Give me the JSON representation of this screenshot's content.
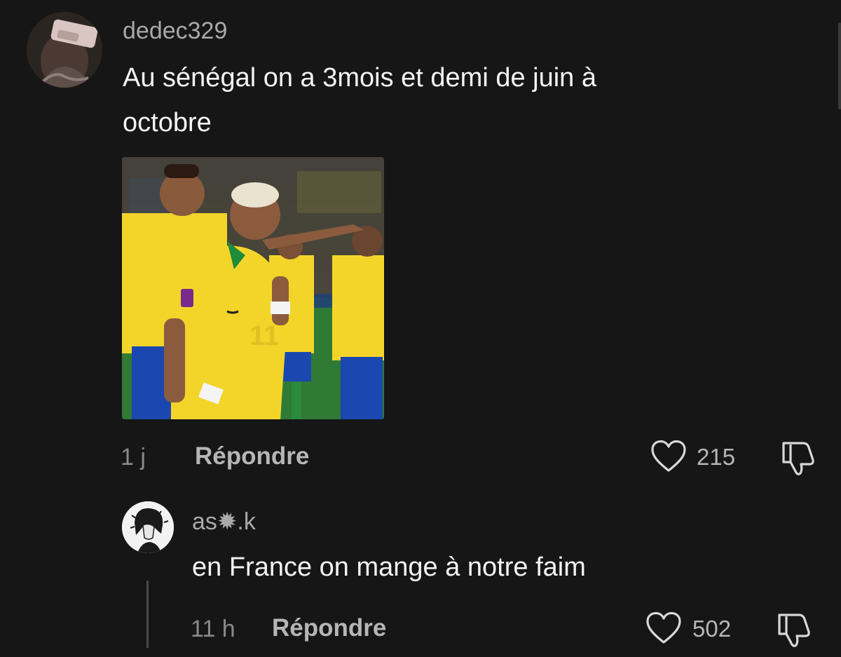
{
  "main_comment": {
    "username": "dedec329",
    "text_line1": "Au sénégal on a 3mois et demi de juin à",
    "text_line2": "octobre",
    "time": "1 j",
    "reply_label": "Répondre",
    "like_count": "215",
    "media_icon": "video-thumbnail"
  },
  "reply_comment": {
    "username": "as✹.k",
    "text": "en France on mange à notre faim",
    "time": "11 h",
    "reply_label": "Répondre",
    "like_count": "502"
  },
  "icons": {
    "like": "heart-outline-icon",
    "dislike": "thumbs-down-outline-icon"
  },
  "colors": {
    "background": "#161616",
    "text": "#f4f4f4",
    "muted": "#a9a9a9",
    "jersey_yellow": "#f3d52a",
    "jersey_green": "#1f8a3a",
    "shorts_blue": "#1b47b0"
  }
}
